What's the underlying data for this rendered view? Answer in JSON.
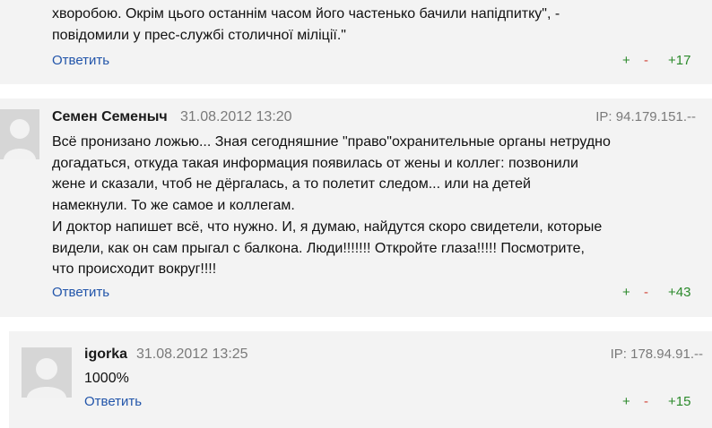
{
  "comments": [
    {
      "text": "хворобою. Окрім цього останнім часом його частенько бачили напідпитку\", -\nповідомили у прес-службі столичної міліції.\"",
      "reply_label": "Ответить",
      "plus": "+",
      "minus": "-",
      "score": "+17"
    },
    {
      "author": "Семен Семеныч",
      "date": "31.08.2012 13:20",
      "ip": "IP: 94.179.151.--",
      "text": "Всё пронизано ложью... Зная сегодняшние \"право\"охранительные органы нетрудно\nдогадаться, откуда такая информация появилась от жены и коллег: позвонили\nжене и сказали, чтоб не дёргалась, а то полетит следом... или на детей\nнамекнули. То же самое и коллегам.\nИ доктор напишет всё, что нужно. И, я думаю, найдутся скоро свидетели, которые\nвидели, как он сам прыгал с балкона. Люди!!!!!!! Откройте глаза!!!!! Посмотрите,\nчто происходит вокруг!!!!",
      "reply_label": "Ответить",
      "plus": "+",
      "minus": "-",
      "score": "+43"
    },
    {
      "author": "igorka",
      "date": "31.08.2012 13:25",
      "ip": "IP: 178.94.91.--",
      "text": "1000%",
      "reply_label": "Ответить",
      "plus": "+",
      "minus": "-",
      "score": "+15"
    }
  ],
  "colors": {
    "background": "#f3f3f3",
    "link": "#2255aa",
    "plus": "#2b8a2b",
    "minus": "#d0453a"
  },
  "icons": {
    "avatar": "default-user-avatar-icon"
  }
}
